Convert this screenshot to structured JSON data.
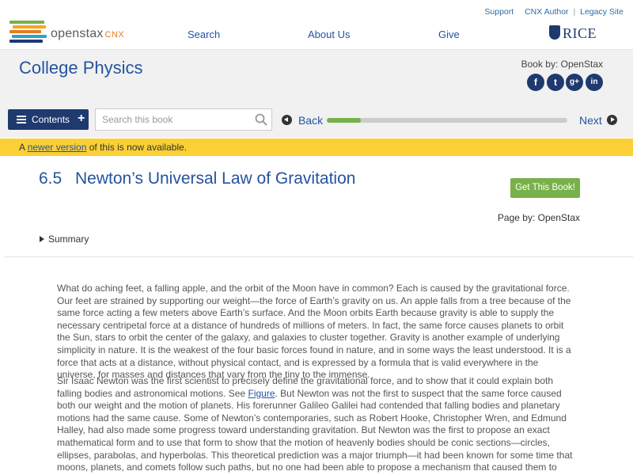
{
  "header": {
    "logo_text": "openstax",
    "logo_suffix": "CNX",
    "links": {
      "support": "Support",
      "author": "CNX Author",
      "legacy": "Legacy Site"
    },
    "nav": {
      "search": "Search",
      "about": "About Us",
      "give": "Give"
    },
    "partner": "RICE"
  },
  "book": {
    "title": "College Physics",
    "by": "Book by: OpenStax",
    "social": {
      "facebook": "f",
      "twitter": "t",
      "google": "g+",
      "linkedin": "in"
    }
  },
  "toolbar": {
    "contents_label": "Contents",
    "search_placeholder": "Search this book",
    "back_label": "Back",
    "next_label": "Next",
    "progress_fraction": 0.14
  },
  "notice": {
    "prefix": "A ",
    "link": "newer version",
    "suffix": " of this is now available."
  },
  "section": {
    "number": "6.5",
    "title": "Newton’s Universal Law of Gravitation",
    "get_book": "Get This Book!",
    "page_by": "Page by: OpenStax",
    "summary": "Summary"
  },
  "content": {
    "para1": "What do aching feet, a falling apple, and the orbit of the Moon have in common? Each is caused by the gravitational force. Our feet are strained by supporting our weight—the force of Earth’s gravity on us. An apple falls from a tree because of the same force acting a few meters above Earth’s surface. And the Moon orbits Earth because gravity is able to supply the necessary centripetal force at a distance of hundreds of millions of meters. In fact, the same force causes planets to orbit the Sun, stars to orbit the center of the galaxy, and galaxies to cluster together. Gravity is another example of underlying simplicity in nature. It is the weakest of the four basic forces found in nature, and in some ways the least understood. It is a force that acts at a distance, without physical contact, and is expressed by a formula that is valid everywhere in the universe, for masses and distances that vary from the tiny to the immense.",
    "para2_a": "Sir Isaac Newton was the first scientist to precisely define the gravitational force, and to show that it could explain both falling bodies and astronomical motions. See ",
    "para2_link": "Figure",
    "para2_b": ". But Newton was not the first to suspect that the same force caused both our weight and the motion of planets. His forerunner Galileo Galilei had contended that falling bodies and planetary motions had the same cause. Some of Newton’s contemporaries, such as Robert Hooke, Christopher Wren, and Edmund Halley, had also made some progress toward understanding gravitation. But Newton was the first to propose an exact mathematical form and to use that form to show that the motion of heavenly bodies should be conic sections—circles, ellipses, parabolas, and hyperbolas. This theoretical prediction was a major triumph—it had been known for some time that moons, planets, and comets follow such paths, but no one had been able to propose a mechanism that caused them to follow these paths and not others."
  },
  "colors": {
    "brand_blue": "#1e3a6e",
    "link_blue": "#24539f",
    "progress_green": "#78b04a",
    "notice_yellow": "#fbd035",
    "logo_orange": "#e87c22"
  }
}
